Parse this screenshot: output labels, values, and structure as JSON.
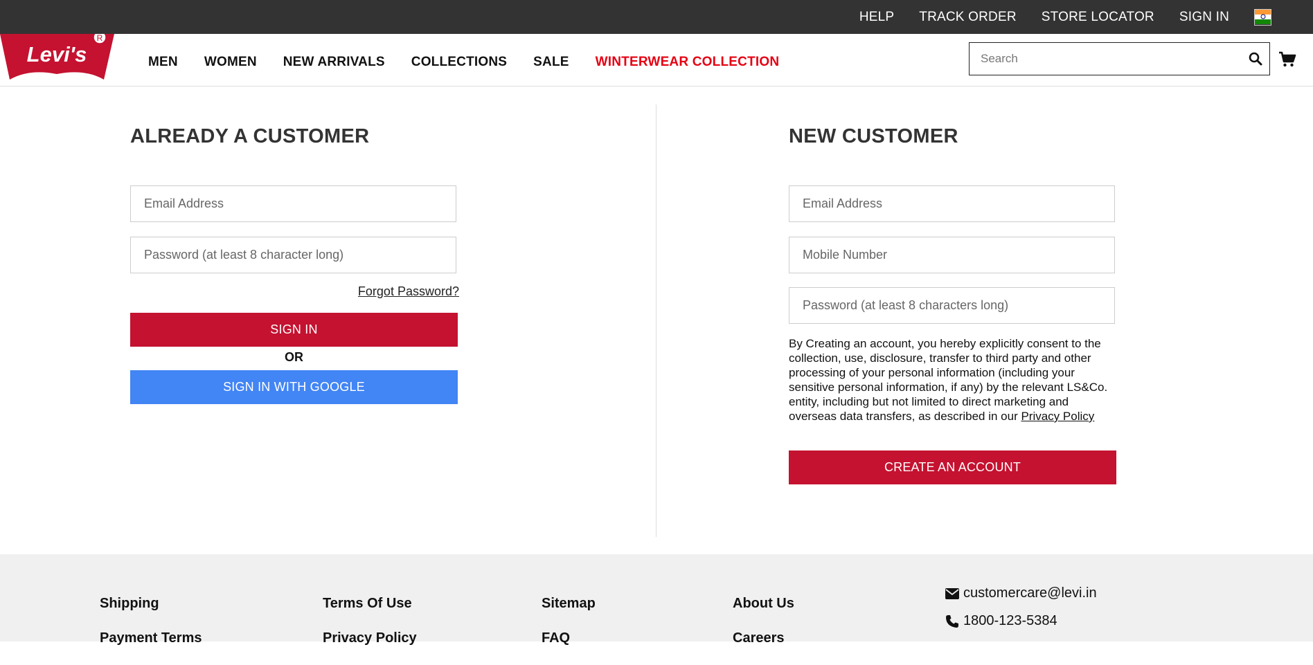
{
  "topbar": {
    "links": [
      "HELP",
      "TRACK ORDER",
      "STORE LOCATOR",
      "SIGN IN"
    ]
  },
  "header": {
    "logo_text": "Levi's",
    "nav": [
      "MEN",
      "WOMEN",
      "NEW ARRIVALS",
      "COLLECTIONS",
      "SALE",
      "WINTERWEAR COLLECTION"
    ],
    "search_placeholder": "Search"
  },
  "colors": {
    "brand_red": "#c41230",
    "google_blue": "#4285f4",
    "nav_highlight": "#e50012",
    "topbar_bg": "#333333"
  },
  "existing": {
    "title": "ALREADY A CUSTOMER",
    "email_placeholder": "Email Address",
    "password_placeholder": "Password (at least 8 character long)",
    "forgot": "Forgot Password?",
    "signin": "SIGN IN",
    "or": "OR",
    "google": "SIGN IN WITH GOOGLE"
  },
  "new_customer": {
    "title": "NEW CUSTOMER",
    "email_placeholder": "Email Address",
    "mobile_placeholder": "Mobile Number",
    "password_placeholder": "Password (at least 8 characters long)",
    "consent_text": "By Creating an account, you hereby explicitly consent to the collection, use, disclosure, transfer to third party and other processing of your personal information (including your sensitive personal information, if any) by the relevant LS&Co. entity, including but not limited to direct marketing and overseas data transfers, as described in our ",
    "privacy_link": "Privacy Policy",
    "create": "CREATE AN ACCOUNT"
  },
  "footer": {
    "col1": [
      "Shipping",
      "Payment Terms"
    ],
    "col2": [
      "Terms Of Use",
      "Privacy Policy"
    ],
    "col3": [
      "Sitemap",
      "FAQ"
    ],
    "col4": [
      "About Us",
      "Careers"
    ],
    "email": "customercare@levi.in",
    "phone": "1800-123-5384"
  }
}
